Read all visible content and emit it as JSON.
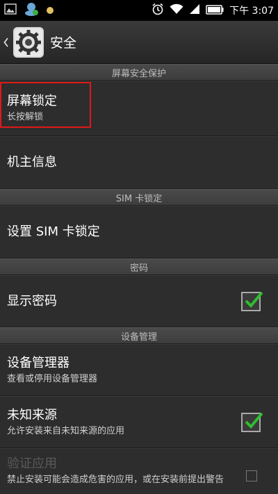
{
  "statusbar": {
    "time": "下午 3:07"
  },
  "actionbar": {
    "title": "安全"
  },
  "sections": {
    "screen_security": "屏幕安全保护",
    "sim_lock": "SIM 卡锁定",
    "password": "密码",
    "device_admin": "设备管理"
  },
  "items": {
    "screen_lock": {
      "title": "屏幕锁定",
      "sub": "长按解锁"
    },
    "owner_info": {
      "title": "机主信息"
    },
    "sim_lock": {
      "title": "设置 SIM 卡锁定"
    },
    "show_password": {
      "title": "显示密码",
      "checked": true
    },
    "device_admins": {
      "title": "设备管理器",
      "sub": "查看或停用设备管理器"
    },
    "unknown_sources": {
      "title": "未知来源",
      "sub": "允许安装来自未知来源的应用",
      "checked": true
    },
    "verify_apps": {
      "title": "验证应用",
      "sub": "禁止安装可能会造成危害的应用，或在安装前提出警告",
      "checked": false
    }
  },
  "colors": {
    "highlight": "#e01818",
    "check": "#2fbd2f"
  }
}
